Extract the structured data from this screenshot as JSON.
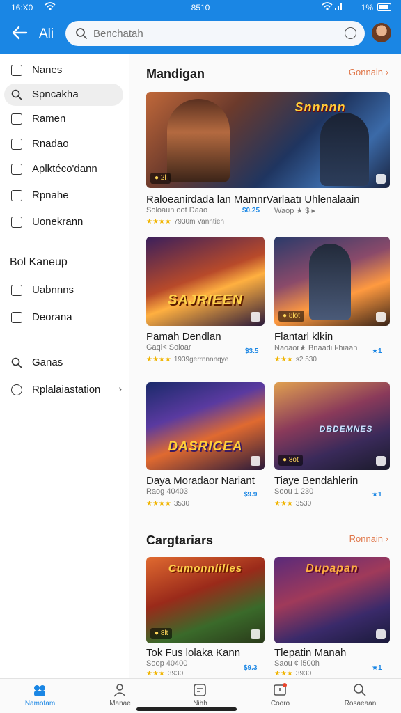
{
  "status": {
    "time": "16:X0",
    "center": "8510",
    "battery": "1%"
  },
  "header": {
    "title": "Ali",
    "search_placeholder": "Benchatah"
  },
  "sidebar": {
    "items": [
      {
        "label": "Nanes",
        "active": false,
        "icon": "download-icon"
      },
      {
        "label": "Spncakha",
        "active": true,
        "icon": "search-icon"
      },
      {
        "label": "Ramen",
        "active": false,
        "icon": "list-icon"
      },
      {
        "label": "Rnadao",
        "active": false,
        "icon": "image-icon"
      },
      {
        "label": "Aplktéco'dann",
        "active": false,
        "icon": "apps-icon"
      },
      {
        "label": "Rpnahe",
        "active": false,
        "icon": "edit-icon"
      },
      {
        "label": "Uonekrann",
        "active": false,
        "icon": "folder-icon"
      }
    ],
    "section2_title": "Bol Kaneup",
    "items2": [
      {
        "label": "Uabnnns",
        "icon": "settings-icon"
      },
      {
        "label": "Deorana",
        "icon": "grid-icon"
      }
    ],
    "items3": [
      {
        "label": "Ganas",
        "icon": "search-icon"
      },
      {
        "label": "Rplalaiastation",
        "icon": "gear-icon"
      }
    ]
  },
  "main": {
    "section1": {
      "title": "Mandigan",
      "link": "Gonnain"
    },
    "featured": {
      "logo": "Snnnnn",
      "badge": "● 2l",
      "title": "Raloeanirdada lan MamnrVarlaatı Uhlenalaain",
      "sub": "Soloaun oot Daao",
      "price": "$0.25",
      "extra": "Waop ★ $ ▸",
      "stars": "★★★★",
      "reviews": "7930m Vanntien"
    },
    "grid1": [
      {
        "logo": "SAJRIEEN",
        "badge": "",
        "title": "Pamah Dendlan",
        "sub": "Gaqi< Soloar",
        "stars": "★★★★",
        "reviews": "1939gerrnnnnqye",
        "price": "$3.5"
      },
      {
        "logo": "",
        "badge": "● 8lot",
        "title": "Flantarl klkin",
        "sub": "Naoaor★ Bnaadi l-hiaan",
        "stars": "★★★",
        "reviews": "s2 530",
        "price": "★1"
      }
    ],
    "grid2": [
      {
        "logo": "DASRICEA",
        "badge": "",
        "title": "Daya Moradaor Nariant",
        "sub": "Raog 40403",
        "stars": "★★★★",
        "reviews": "3530",
        "price": "$9.9"
      },
      {
        "logo": "DBDEMNES",
        "badge": "● 8ot",
        "title": "Tiaye Bendahlerin",
        "sub": "Soou 1 230",
        "stars": "★★★",
        "reviews": "3530",
        "price": "★1"
      }
    ],
    "section2": {
      "title": "Cargtariars",
      "link": "Ronnain"
    },
    "grid3": [
      {
        "logo": "Cumonnlilles",
        "badge": "● 8lt",
        "title": "Tok Fus lolaka Kann",
        "sub": "Soop 40400",
        "stars": "★★★",
        "reviews": "3930",
        "price": "$9.3"
      },
      {
        "logo": "Dupapan",
        "badge": "",
        "title": "Tlepatin Manah",
        "sub": "Saou ¢ l500h",
        "stars": "★★★",
        "reviews": "3930",
        "price": "★1"
      }
    ]
  },
  "bottom_nav": [
    {
      "label": "Namotam",
      "icon": "home-icon",
      "active": true
    },
    {
      "label": "Manae",
      "icon": "person-icon",
      "active": false
    },
    {
      "label": "Nihh",
      "icon": "message-icon",
      "active": false
    },
    {
      "label": "Cooro",
      "icon": "notification-icon",
      "active": false
    },
    {
      "label": "Rosaeaan",
      "icon": "search-icon",
      "active": false
    }
  ],
  "colors": {
    "primary": "#1a86e4",
    "accent_link": "#e0774a",
    "stars": "#f0b400"
  }
}
